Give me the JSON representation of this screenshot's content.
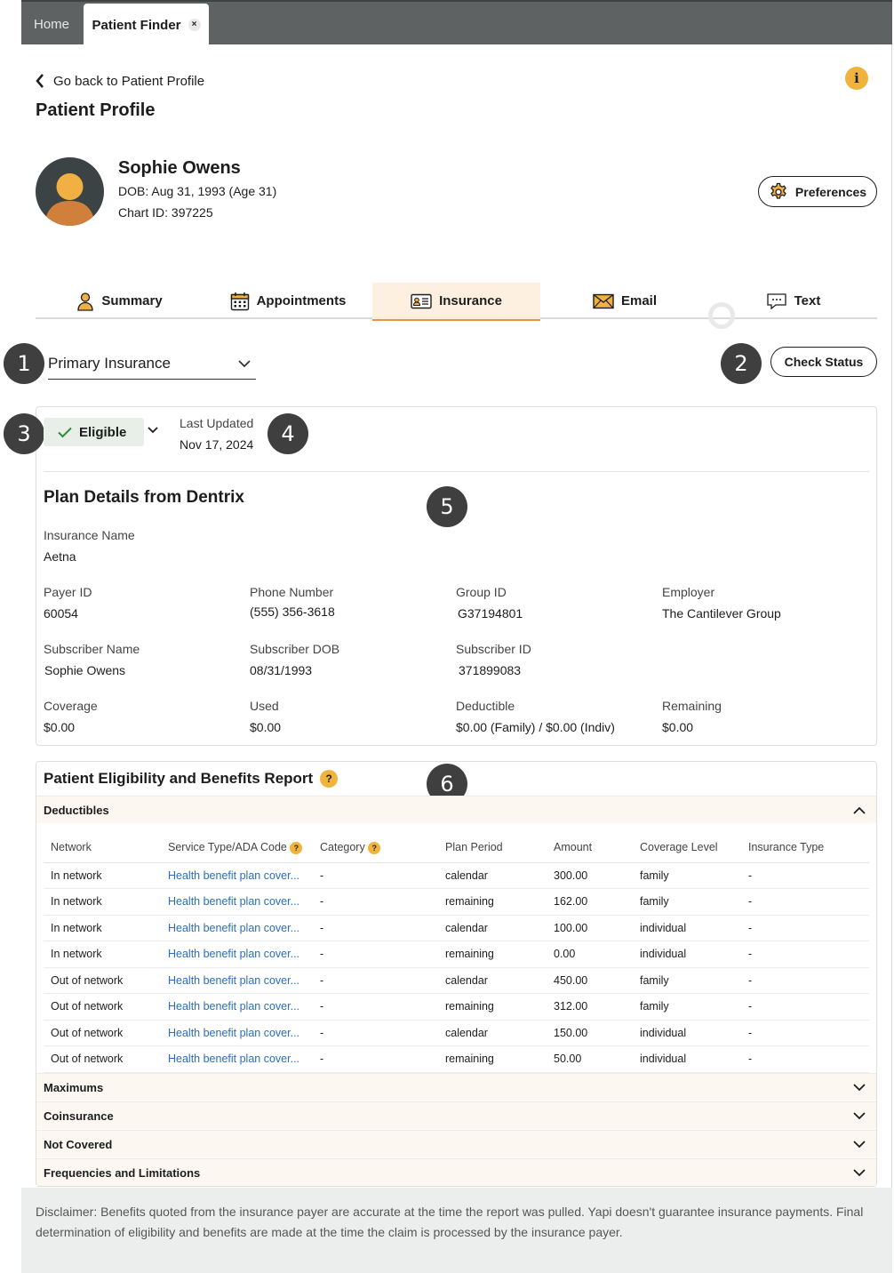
{
  "tabs": {
    "home": "Home",
    "active": "Patient Finder",
    "close": "×"
  },
  "header": {
    "back_label": "Go back to Patient Profile",
    "info": "i",
    "title": "Patient Profile"
  },
  "patient": {
    "name": "Sophie Owens",
    "dob_label": "DOB:",
    "dob_value": "Aug 31, 1993 (Age 31)",
    "chart_label": "Chart ID:",
    "chart_value": "397225",
    "preferences_label": "Preferences"
  },
  "nav": {
    "summary": "Summary",
    "appointments": "Appointments",
    "insurance": "Insurance",
    "email": "Email",
    "text": "Text"
  },
  "badges": [
    "1",
    "2",
    "3",
    "4",
    "5",
    "6"
  ],
  "insurance": {
    "select_value": "Primary Insurance",
    "check_status": "Check Status",
    "eligibility": "Eligible",
    "last_updated_label": "Last Updated",
    "last_updated_value": "Nov 17, 2024"
  },
  "plan": {
    "title": "Plan Details from Dentrix",
    "insurance_name_label": "Insurance Name",
    "insurance_name": "Aetna",
    "payer_id_label": "Payer ID",
    "payer_id": "60054",
    "phone_label": "Phone Number",
    "phone": "(555) 356-3618",
    "group_label": "Group ID",
    "group": "G37194801",
    "employer_label": "Employer",
    "employer": "The Cantilever Group",
    "sub_name_label": "Subscriber Name",
    "sub_name": "Sophie Owens",
    "sub_dob_label": "Subscriber DOB",
    "sub_dob": "08/31/1993",
    "sub_id_label": "Subscriber ID",
    "sub_id": "371899083",
    "coverage_label": "Coverage",
    "coverage": "$0.00",
    "used_label": "Used",
    "used": "$0.00",
    "deductible_label": "Deductible",
    "deductible": "$0.00 (Family) / $0.00 (Indiv)",
    "remaining_label": "Remaining",
    "remaining": "$0.00"
  },
  "report": {
    "title": "Patient Eligibility and Benefits Report",
    "help": "?",
    "sections": {
      "deductibles": "Deductibles",
      "maximums": "Maximums",
      "coinsurance": "Coinsurance",
      "not_covered": "Not Covered",
      "frequencies": "Frequencies and Limitations"
    },
    "columns": [
      "Network",
      "Service Type/ADA Code",
      "Category",
      "Plan Period",
      "Amount",
      "Coverage Level",
      "Insurance Type"
    ],
    "rows": [
      [
        "In network",
        "Health benefit plan cover...",
        "-",
        "calendar",
        "300.00",
        "family",
        "-"
      ],
      [
        "In network",
        "Health benefit plan cover...",
        "-",
        "remaining",
        "162.00",
        "family",
        "-"
      ],
      [
        "In network",
        "Health benefit plan cover...",
        "-",
        "calendar",
        "100.00",
        "individual",
        "-"
      ],
      [
        "In network",
        "Health benefit plan cover...",
        "-",
        "remaining",
        "0.00",
        "individual",
        "-"
      ],
      [
        "Out of network",
        "Health benefit plan cover...",
        "-",
        "calendar",
        "450.00",
        "family",
        "-"
      ],
      [
        "Out of network",
        "Health benefit plan cover...",
        "-",
        "remaining",
        "312.00",
        "family",
        "-"
      ],
      [
        "Out of network",
        "Health benefit plan cover...",
        "-",
        "calendar",
        "150.00",
        "individual",
        "-"
      ],
      [
        "Out of network",
        "Health benefit plan cover...",
        "-",
        "remaining",
        "50.00",
        "individual",
        "-"
      ]
    ]
  },
  "disclaimer": "Disclaimer: Benefits quoted from the insurance payer are accurate at the time the report was pulled. Yapi doesn't guarantee insurance payments. Final determination of eligibility and benefits are made at the time the claim is processed by the insurance payer."
}
